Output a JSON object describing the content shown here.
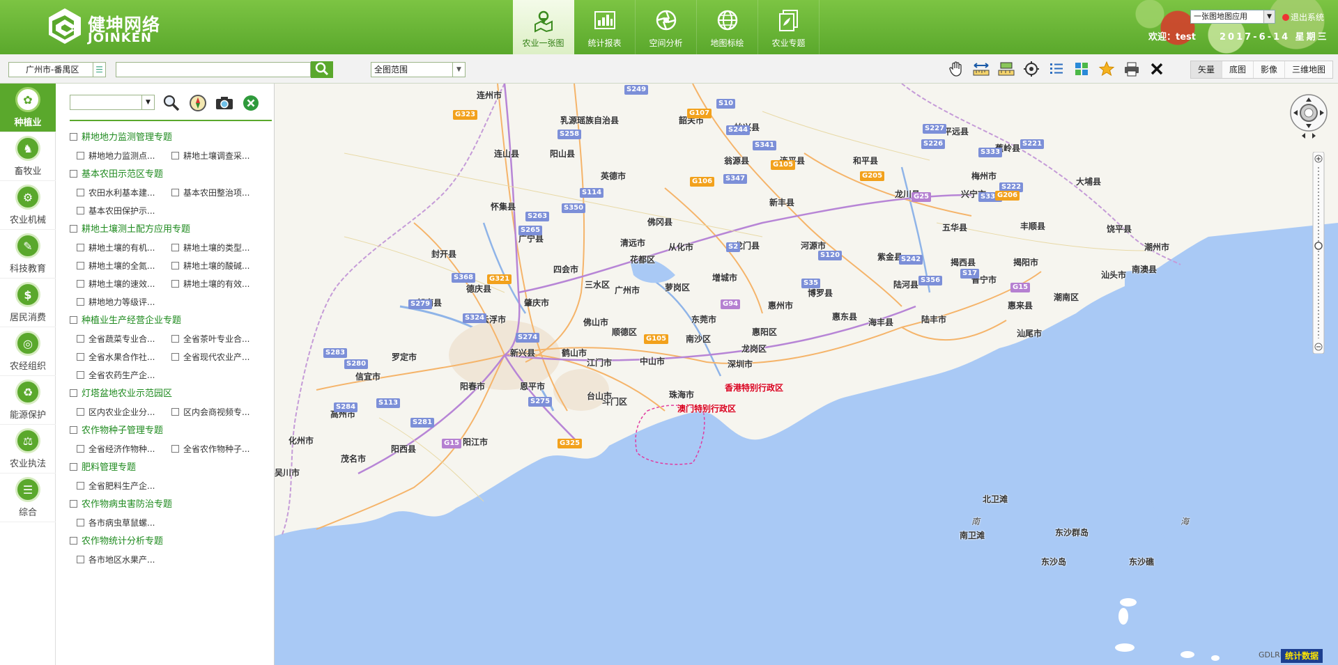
{
  "header": {
    "logo_cn": "健坤网络",
    "logo_en": "JOINKEN",
    "nav": [
      {
        "label": "农业一张图",
        "icon": "map-pin-icon",
        "active": true
      },
      {
        "label": "统计报表",
        "icon": "report-icon",
        "active": false
      },
      {
        "label": "空间分析",
        "icon": "aperture-icon",
        "active": false
      },
      {
        "label": "地图标绘",
        "icon": "globe-icon",
        "active": false
      },
      {
        "label": "农业专题",
        "icon": "topic-icon",
        "active": false
      }
    ],
    "app_select": "一张图地图应用",
    "logout": "退出系统",
    "welcome": "欢迎：test",
    "date": "2017-6-14 星期三"
  },
  "toolbar": {
    "region": "广州市-番禺区",
    "search_value": "",
    "scope": "全图范围",
    "tools": [
      "pan-hand-icon",
      "measure-distance-icon",
      "measure-area-icon",
      "locate-icon",
      "list-icon",
      "grid-icon",
      "star-icon",
      "print-icon",
      "clear-icon"
    ],
    "map_types": [
      "矢量",
      "底图",
      "影像",
      "三维地图"
    ]
  },
  "categories": [
    {
      "label": "种植业",
      "glyph": "✿",
      "active": true
    },
    {
      "label": "畜牧业",
      "glyph": "♞",
      "active": false
    },
    {
      "label": "农业机械",
      "glyph": "⚙",
      "active": false
    },
    {
      "label": "科技教育",
      "glyph": "✎",
      "active": false
    },
    {
      "label": "居民消费",
      "glyph": "$",
      "active": false
    },
    {
      "label": "农经组织",
      "glyph": "◎",
      "active": false
    },
    {
      "label": "能源保护",
      "glyph": "♻",
      "active": false
    },
    {
      "label": "农业执法",
      "glyph": "⚖",
      "active": false
    },
    {
      "label": "综合",
      "glyph": "☰",
      "active": false
    }
  ],
  "layer_tree": [
    {
      "title": "耕地地力监测管理专题",
      "items": [
        "耕地地力监测点...",
        "耕地土壤调查采..."
      ]
    },
    {
      "title": "基本农田示范区专题",
      "items": [
        "农田水利基本建...",
        "基本农田整治项...",
        "基本农田保护示..."
      ]
    },
    {
      "title": "耕地土壤测土配方应用专题",
      "items": [
        "耕地土壤的有机...",
        "耕地土壤的类型...",
        "耕地土壤的全氮...",
        "耕地土壤的酸碱...",
        "耕地土壤的速效...",
        "耕地土壤的有效...",
        "耕地地力等级评..."
      ]
    },
    {
      "title": "种植业生产经营企业专题",
      "items": [
        "全省蔬菜专业合...",
        "全省茶叶专业合...",
        "全省水果合作社...",
        "全省现代农业产...",
        "全省农药生产企..."
      ]
    },
    {
      "title": "灯塔盆地农业示范园区",
      "items": [
        "区内农业企业分...",
        "区内会商视频专..."
      ]
    },
    {
      "title": "农作物种子管理专题",
      "items": [
        "全省经济作物种...",
        "全省农作物种子..."
      ]
    },
    {
      "title": "肥料管理专题",
      "items": [
        "全省肥料生产企..."
      ]
    },
    {
      "title": "农作物病虫害防治专题",
      "items": [
        "各市病虫草鼠螺..."
      ]
    },
    {
      "title": "农作物统计分析专题",
      "items": [
        "各市地区水果产..."
      ]
    }
  ],
  "map": {
    "places": [
      "连州市",
      "乳源瑶族自治县",
      "韶关市",
      "始兴县",
      "平远县",
      "蕉岭县",
      "连山县",
      "阳山县",
      "翁源县",
      "连平县",
      "和平县",
      "梅州市",
      "大埔县",
      "英德市",
      "怀集县",
      "龙川县",
      "兴宁市",
      "新丰县",
      "佛冈县",
      "丰顺县",
      "五华县",
      "广宁县",
      "清远市",
      "从化市",
      "龙门县",
      "河源市",
      "饶平县",
      "潮州市",
      "封开县",
      "花都区",
      "四会市",
      "紫金县",
      "揭西县",
      "揭阳市",
      "南澳县",
      "三水区",
      "广州市",
      "萝岗区",
      "增城市",
      "汕头市",
      "德庆县",
      "博罗县",
      "陆河县",
      "普宁市",
      "郁南县",
      "肇庆市",
      "惠州市",
      "惠来县",
      "潮南区",
      "云浮市",
      "佛山市",
      "东莞市",
      "惠东县",
      "陆丰市",
      "海丰县",
      "惠阳区",
      "顺德区",
      "南沙区",
      "汕尾市",
      "龙岗区",
      "罗定市",
      "新兴县",
      "鹤山市",
      "江门市",
      "中山市",
      "深圳市",
      "信宜市",
      "阳春市",
      "恩平市",
      "台山市",
      "珠海市",
      "斗门区",
      "高州市",
      "化州市",
      "阳西县",
      "阳江市",
      "茂名市",
      "吴川市",
      "北卫滩",
      "南卫滩",
      "东沙群岛",
      "东沙岛",
      "东沙礁"
    ],
    "special_regions": [
      "香港特别行政区",
      "澳门特别行政区"
    ],
    "sea_labels": [
      "南",
      "海"
    ],
    "shields": [
      "S249",
      "G323",
      "S10",
      "S244",
      "S258",
      "G107",
      "S341",
      "S227",
      "S226",
      "S221",
      "S333",
      "G105",
      "G106",
      "S347",
      "G205",
      "G25",
      "S222",
      "S334",
      "S114",
      "S350",
      "G206",
      "S263",
      "S265",
      "S2",
      "S120",
      "S242",
      "S17",
      "S368",
      "G321",
      "S35",
      "S356",
      "G15",
      "S279",
      "G94",
      "S324",
      "S274",
      "G105",
      "S283",
      "S280",
      "S284",
      "S113",
      "S275",
      "S281",
      "G325",
      "G15"
    ],
    "copyright": "GDLRIC",
    "stats_button": "统计数据"
  }
}
